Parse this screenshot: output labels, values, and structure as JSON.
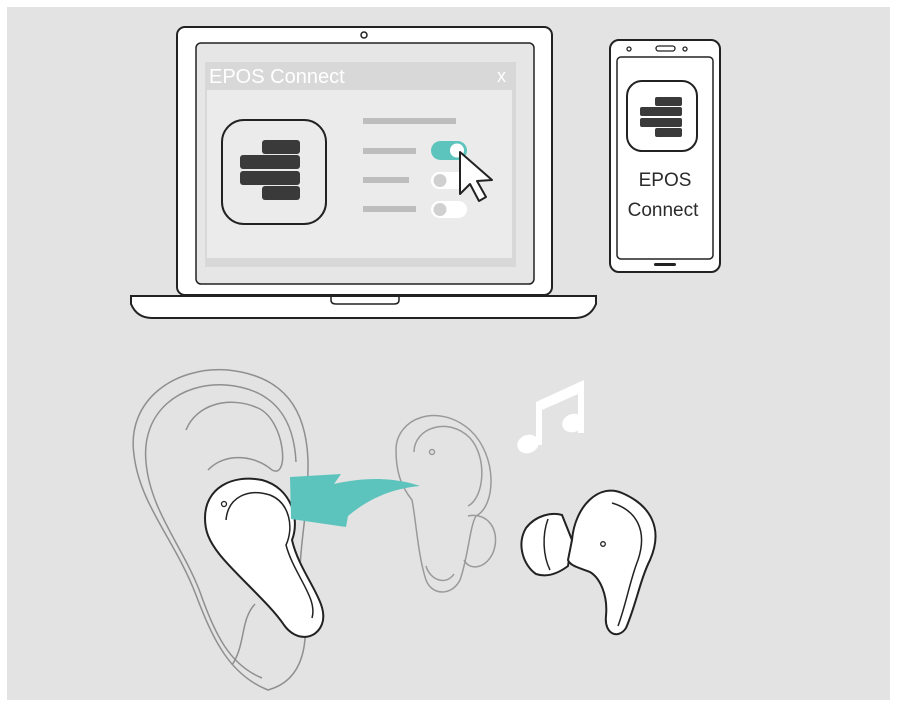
{
  "laptop_window": {
    "title": "EPOS Connect",
    "close_label": "x",
    "toggles": [
      {
        "state": "on"
      },
      {
        "state": "off"
      },
      {
        "state": "off"
      }
    ]
  },
  "phone": {
    "app_label_line1": "EPOS",
    "app_label_line2": "Connect"
  },
  "colors": {
    "background": "#e3e3e3",
    "accent_teal": "#5cc4bd",
    "outline": "#222222",
    "logo_bars": "#3a3a3a",
    "window_bar": "#d8d8d8"
  },
  "icons": {
    "music": "music-note-icon",
    "cursor": "mouse-pointer-icon",
    "arrow": "insert-arrow-icon",
    "logo": "epos-logo-icon"
  }
}
